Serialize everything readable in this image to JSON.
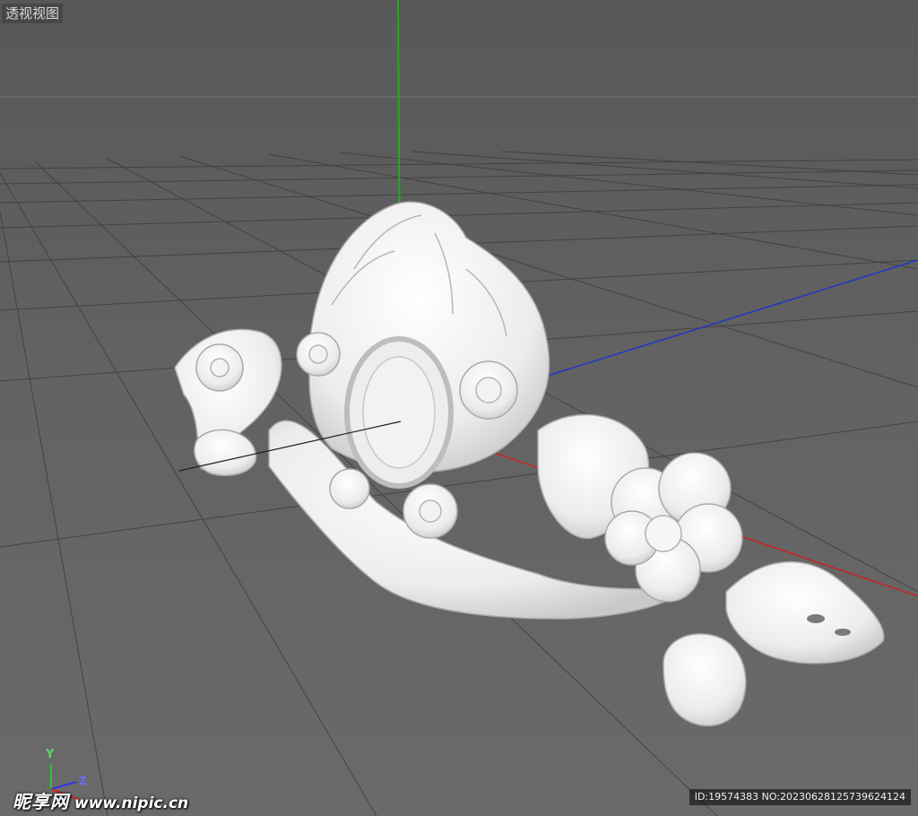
{
  "viewport": {
    "label": "透视视图",
    "axis_colors": {
      "x": "#cc2222",
      "y": "#22aa22",
      "z": "#2233cc"
    }
  },
  "axis_indicator": {
    "y_label": "Y",
    "z_label": "Z"
  },
  "watermark": {
    "brand": "昵享网",
    "url": "www.nipic.cn"
  },
  "image_id": "ID:19574383 NO:20230628125739624124"
}
